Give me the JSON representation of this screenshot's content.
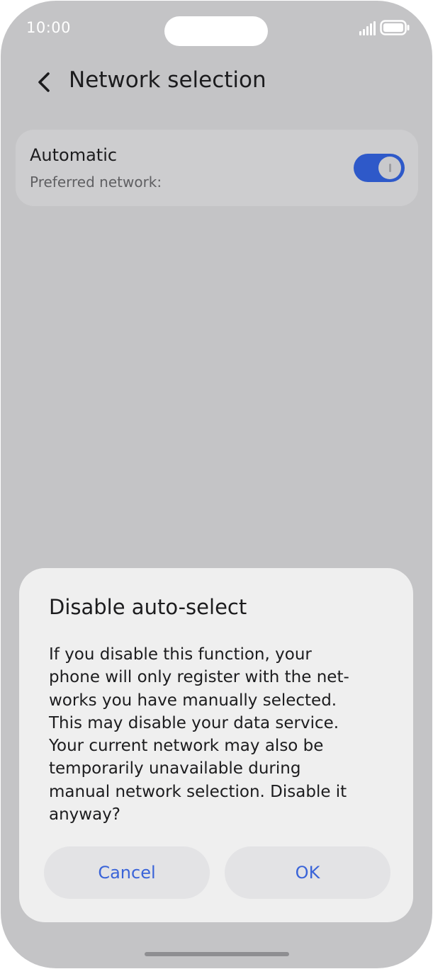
{
  "status_bar": {
    "time": "10:00",
    "signal_icon": "signal-icon",
    "battery_icon": "battery-icon"
  },
  "header": {
    "back_icon": "chevron-left-icon",
    "title": "Network selection"
  },
  "automatic_card": {
    "title": "Automatic",
    "subtitle": "Preferred network:",
    "toggle_on": true,
    "toggle_color": "#2e59c9"
  },
  "dialog": {
    "title": "Disable auto-select",
    "body": "If you disable this function, your\nphone will only register with the net-\nworks you have manually selected.\nThis may disable your data service.\nYour current network may also be\ntemporarily unavailable during\nmanual network selection. Disable it\nanyway?",
    "cancel_label": "Cancel",
    "ok_label": "OK",
    "button_text_color": "#3a64d8"
  }
}
